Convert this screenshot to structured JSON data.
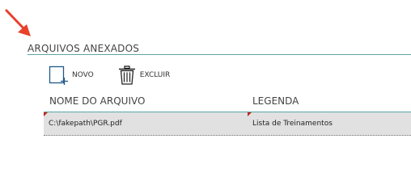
{
  "section": {
    "title": "ARQUIVOS ANEXADOS"
  },
  "toolbar": {
    "new_label": "NOVO",
    "delete_label": "EXCLUIR"
  },
  "grid": {
    "columns": [
      "NOME DO ARQUIVO",
      "LEGENDA"
    ],
    "rows": [
      {
        "file": "C:\\fakepath\\PGR.pdf",
        "caption": "Lista de Treinamentos"
      }
    ]
  },
  "icons": {
    "annotation": "red-arrow-icon",
    "new": "new-document-icon",
    "delete": "trash-icon"
  },
  "colors": {
    "accent_rule": "#5aa6a8",
    "arrow": "#e8412c",
    "row_background": "#e1e1e1",
    "dirty_marker": "#c0271c"
  }
}
